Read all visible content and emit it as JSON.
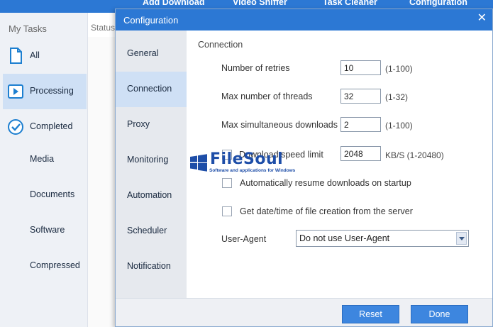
{
  "toolbar": {
    "items": [
      {
        "label": "Add Download"
      },
      {
        "label": "Video Sniffer"
      },
      {
        "label": "Task Cleaner"
      },
      {
        "label": "Configuration"
      }
    ]
  },
  "sidebar": {
    "title": "My Tasks",
    "items": [
      {
        "label": "All",
        "icon": "document-icon"
      },
      {
        "label": "Processing",
        "icon": "play-icon",
        "active": true
      },
      {
        "label": "Completed",
        "icon": "check-circle-icon"
      },
      {
        "label": "Media"
      },
      {
        "label": "Documents"
      },
      {
        "label": "Software"
      },
      {
        "label": "Compressed"
      }
    ]
  },
  "task_list": {
    "status_header": "Status"
  },
  "dialog": {
    "title": "Configuration",
    "close": "✕",
    "nav": [
      {
        "label": "General"
      },
      {
        "label": "Connection",
        "active": true
      },
      {
        "label": "Proxy"
      },
      {
        "label": "Monitoring"
      },
      {
        "label": "Automation"
      },
      {
        "label": "Scheduler"
      },
      {
        "label": "Notification"
      }
    ],
    "connection": {
      "section_title": "Connection",
      "retries": {
        "label": "Number of retries",
        "value": "10",
        "range": "(1-100)"
      },
      "threads": {
        "label": "Max number of threads",
        "value": "32",
        "range": "(1-32)"
      },
      "simultaneous": {
        "label": "Max simultaneous downloads",
        "value": "2",
        "range": "(1-100)"
      },
      "speed_limit": {
        "label": "Download speed limit",
        "value": "2048",
        "range": "KB/S (1-20480)",
        "checked": false
      },
      "auto_resume": {
        "label": "Automatically resume downloads on startup",
        "checked": false
      },
      "file_date": {
        "label": "Get date/time of file creation from the server",
        "checked": false
      },
      "user_agent": {
        "label": "User-Agent",
        "selected": "Do not use User-Agent"
      }
    },
    "buttons": {
      "reset": "Reset",
      "done": "Done"
    }
  },
  "watermark": {
    "text": "FileSoul",
    "subtitle": "Software and applications for Windows"
  },
  "colors": {
    "accent": "#2c78d4",
    "selection": "#cfe0f5",
    "button": "#3d86df"
  }
}
